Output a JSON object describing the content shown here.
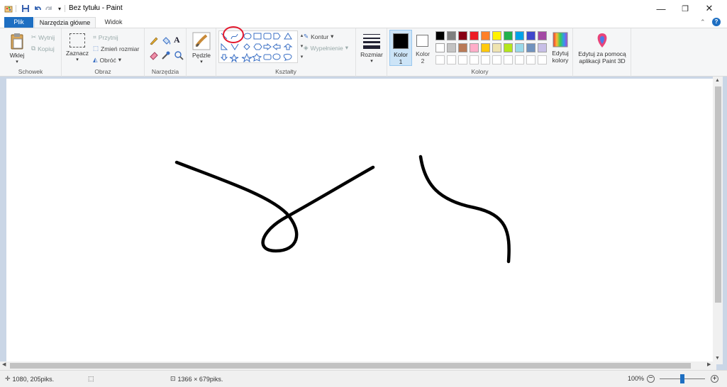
{
  "window": {
    "title": "Bez tytułu - Paint",
    "minimize_glyph": "—",
    "restore_glyph": "❐",
    "close_glyph": "✕"
  },
  "tabs": [
    {
      "label": "Plik"
    },
    {
      "label": "Narzędzia główne"
    },
    {
      "label": "Widok"
    }
  ],
  "ribbon": {
    "clipboard": {
      "paste": "Wklej",
      "cut": "Wytnij",
      "copy": "Kopiuj",
      "group": "Schowek"
    },
    "image": {
      "select": "Zaznacz",
      "crop": "Przytnij",
      "resize": "Zmień rozmiar",
      "rotate": "Obróć",
      "group": "Obraz"
    },
    "tools": {
      "group": "Narzędzia"
    },
    "brushes": {
      "label": "Pędzle"
    },
    "shapes": {
      "outline": "Kontur",
      "fill": "Wypełnienie",
      "group": "Kształty"
    },
    "size": {
      "label": "Rozmiar"
    },
    "colors": {
      "color1": "Kolor",
      "color1_num": "1",
      "color2": "Kolor",
      "color2_num": "2",
      "edit_line1": "Edytuj",
      "edit_line2": "kolory",
      "group": "Kolory",
      "palette_row1": [
        "#000000",
        "#7f7f7f",
        "#880015",
        "#ed1c24",
        "#ff7f27",
        "#fff200",
        "#22b14c",
        "#00a2e8",
        "#3f48cc",
        "#a349a4"
      ],
      "palette_row2": [
        "#ffffff",
        "#c3c3c3",
        "#b97a57",
        "#ffaec9",
        "#ffc90e",
        "#efe4b0",
        "#b5e61d",
        "#99d9ea",
        "#7092be",
        "#c8bfe7"
      ],
      "selected_color1": "#000000",
      "selected_color2": "#ffffff"
    },
    "paint3d": {
      "line1": "Edytuj za pomocą",
      "line2": "aplikacji Paint 3D"
    }
  },
  "status": {
    "cursor_pos": "1080, 205piks.",
    "canvas_size": "1366 × 679piks.",
    "zoom": "100%"
  }
}
